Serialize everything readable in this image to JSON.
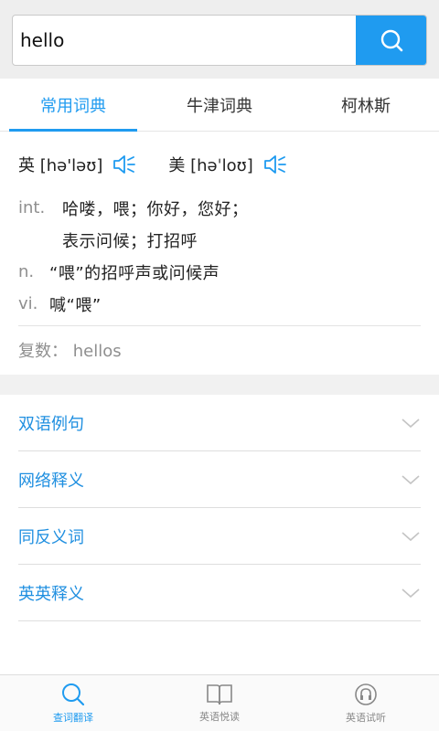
{
  "search": {
    "value": "hello",
    "icon": "search-icon",
    "accent": "#1f9bf0"
  },
  "tabs": [
    {
      "label": "常用词典",
      "active": true
    },
    {
      "label": "牛津词典",
      "active": false
    },
    {
      "label": "柯林斯",
      "active": false
    }
  ],
  "phonetics": {
    "uk": "英 [hə'ləʊ]",
    "us": "美 [həˈloʊ]",
    "speaker_icon": "speaker-icon"
  },
  "definitions": [
    {
      "pos": "int.",
      "meaning": "哈喽，喂；你好，您好；"
    },
    {
      "pos": "",
      "meaning": "表示问候；打招呼"
    },
    {
      "pos": "n.",
      "meaning": "“喂”的招呼声或问候声"
    },
    {
      "pos": "vi.",
      "meaning": "喊“喂”"
    }
  ],
  "plural": "复数： hellos",
  "sections": [
    {
      "label": "双语例句"
    },
    {
      "label": "网络释义"
    },
    {
      "label": "同反义词"
    },
    {
      "label": "英英释义"
    }
  ],
  "bottom_nav": [
    {
      "label": "查词翻译",
      "icon": "search-icon",
      "active": true
    },
    {
      "label": "英语悦读",
      "icon": "book-icon",
      "active": false
    },
    {
      "label": "英语试听",
      "icon": "listen-icon",
      "active": false
    }
  ]
}
